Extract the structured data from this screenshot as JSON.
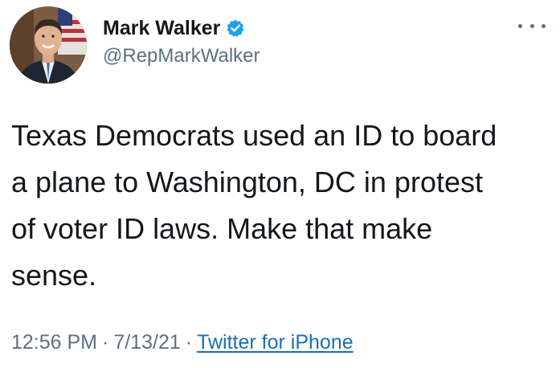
{
  "user": {
    "display_name": "Mark Walker",
    "handle": "@RepMarkWalker",
    "verified": true,
    "avatar_icon": "profile-photo"
  },
  "header": {
    "more_icon": "ellipsis-icon"
  },
  "tweet": {
    "text": "Texas Democrats used an ID to board\na plane to Washington, DC in protest\nof voter ID laws. Make that make\nsense."
  },
  "meta": {
    "time": "12:56 PM",
    "separator": "·",
    "date": "7/13/21",
    "source": "Twitter for iPhone"
  },
  "colors": {
    "text": "#14171a",
    "secondary": "#5b7083",
    "verified_badge": "#1da1f2",
    "link": "#1b6fb5"
  }
}
